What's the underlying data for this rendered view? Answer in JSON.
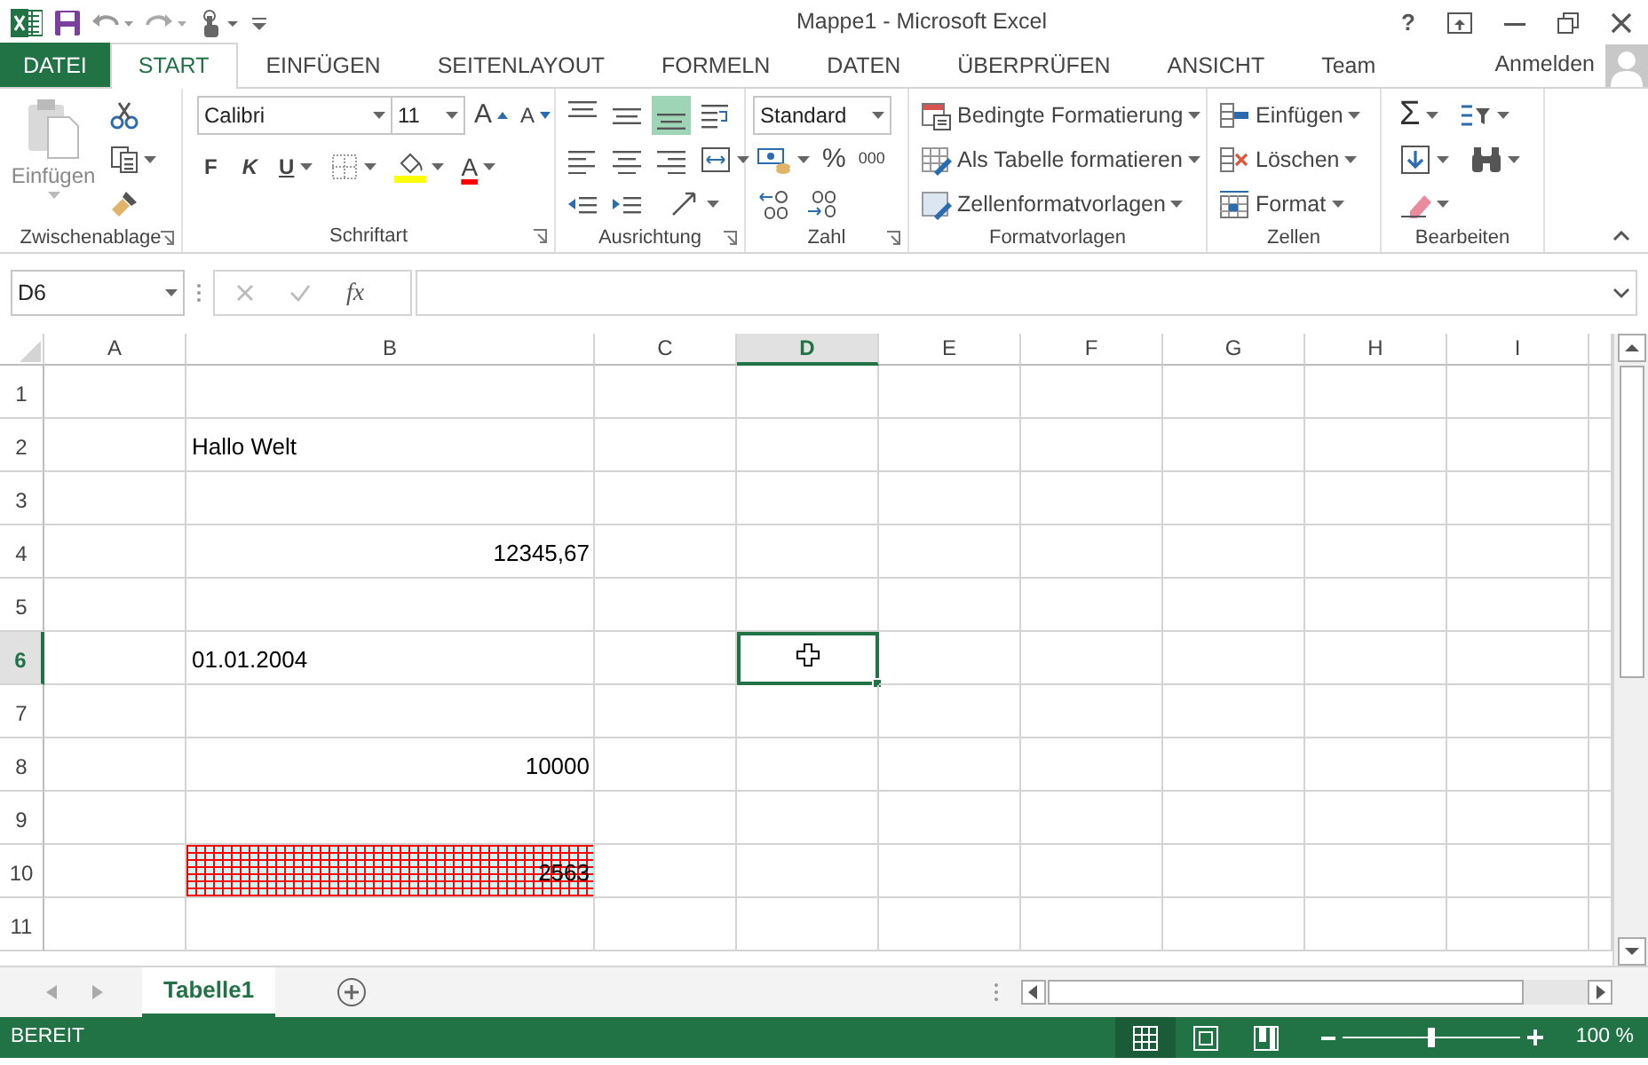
{
  "window": {
    "title": "Mappe1 - Microsoft Excel",
    "help": "?"
  },
  "tabs": [
    {
      "label": "DATEI",
      "kind": "file",
      "selected": false
    },
    {
      "label": "START",
      "kind": "tab",
      "selected": true
    },
    {
      "label": "EINFÜGEN",
      "kind": "tab",
      "selected": false
    },
    {
      "label": "SEITENLAYOUT",
      "kind": "tab",
      "selected": false
    },
    {
      "label": "FORMELN",
      "kind": "tab",
      "selected": false
    },
    {
      "label": "DATEN",
      "kind": "tab",
      "selected": false
    },
    {
      "label": "ÜBERPRÜFEN",
      "kind": "tab",
      "selected": false
    },
    {
      "label": "ANSICHT",
      "kind": "tab",
      "selected": false
    },
    {
      "label": "Team",
      "kind": "tab",
      "selected": false
    }
  ],
  "account": {
    "label": "Anmelden"
  },
  "ribbon": {
    "groups": [
      {
        "kind": "clipboard",
        "name": "Zwischenablage",
        "paste_label": "Einfügen",
        "paste_disabled": true
      },
      {
        "kind": "font",
        "name": "Schriftart",
        "font": "Calibri",
        "size": "11",
        "grow": "A",
        "shrink": "A",
        "bold": "F",
        "italic": "K",
        "underline": "U",
        "font_color": "A"
      },
      {
        "kind": "alignment",
        "name": "Ausrichtung",
        "vertical": [
          {
            "selected": false
          },
          {
            "selected": false
          },
          {
            "selected": true
          }
        ]
      },
      {
        "kind": "number",
        "name": "Zahl",
        "format": "Standard",
        "percent": "%",
        "thousands": "000"
      },
      {
        "kind": "styles",
        "name": "Formatvorlagen",
        "items": [
          "Bedingte Formatierung",
          "Als Tabelle formatieren",
          "Zellenformatvorlagen"
        ]
      },
      {
        "kind": "cells",
        "name": "Zellen",
        "items": [
          "Einfügen",
          "Löschen",
          "Format"
        ]
      },
      {
        "kind": "editing",
        "name": "Bearbeiten",
        "sum": "Σ"
      }
    ]
  },
  "formula_bar": {
    "name_box": "D6",
    "function_label": "fx"
  },
  "grid": {
    "columns": [
      {
        "label": "A",
        "selected": false
      },
      {
        "label": "B",
        "selected": false
      },
      {
        "label": "C",
        "selected": false
      },
      {
        "label": "D",
        "selected": true
      },
      {
        "label": "E",
        "selected": false
      },
      {
        "label": "F",
        "selected": false
      },
      {
        "label": "G",
        "selected": false
      },
      {
        "label": "H",
        "selected": false
      },
      {
        "label": "I",
        "selected": false
      }
    ],
    "rows": [
      {
        "label": "1",
        "selected": false
      },
      {
        "label": "2",
        "selected": false,
        "cells": {
          "B": {
            "text": "Hallo Welt",
            "kind": "text",
            "patterned": false
          }
        }
      },
      {
        "label": "3",
        "selected": false
      },
      {
        "label": "4",
        "selected": false,
        "cells": {
          "B": {
            "text": "12345,67",
            "kind": "number",
            "patterned": false
          }
        }
      },
      {
        "label": "5",
        "selected": false
      },
      {
        "label": "6",
        "selected": true,
        "cells": {
          "B": {
            "text": "01.01.2004",
            "kind": "text",
            "patterned": false
          }
        }
      },
      {
        "label": "7",
        "selected": false
      },
      {
        "label": "8",
        "selected": false,
        "cells": {
          "B": {
            "text": "10000",
            "kind": "number",
            "patterned": false
          }
        }
      },
      {
        "label": "9",
        "selected": false
      },
      {
        "label": "10",
        "selected": false,
        "cells": {
          "B": {
            "text": "2563",
            "kind": "number",
            "patterned": true
          }
        }
      },
      {
        "label": "11",
        "selected": false
      }
    ]
  },
  "sheets": [
    {
      "label": "Tabelle1",
      "selected": true
    }
  ],
  "status_bar": {
    "mode": "BEREIT",
    "views": [
      {
        "kind": "normal",
        "selected": true
      },
      {
        "kind": "page_layout",
        "selected": false
      },
      {
        "kind": "page_break",
        "selected": false
      }
    ],
    "zoom": {
      "level": 0.5,
      "reading": "100 %"
    }
  }
}
